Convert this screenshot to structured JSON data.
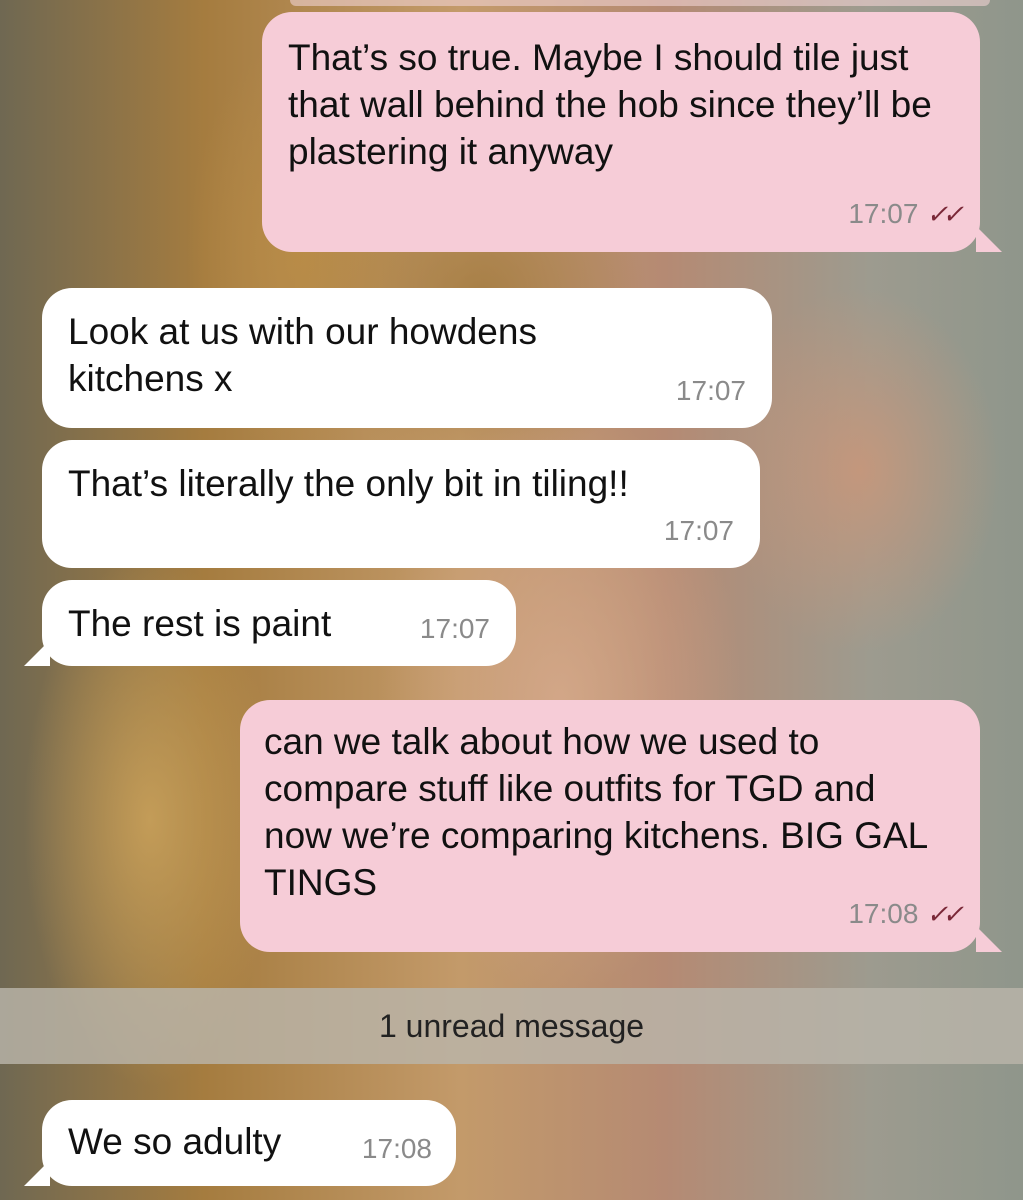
{
  "messages": [
    {
      "direction": "outgoing",
      "text": "That’s so true. Maybe I should tile just that wall behind the hob since they’ll be plastering it anyway",
      "time": "17:07",
      "status": "read"
    },
    {
      "direction": "incoming",
      "text": "Look at us with our howdens kitchens x",
      "time": "17:07"
    },
    {
      "direction": "incoming",
      "text": "That’s literally the only bit in tiling!!",
      "time": "17:07"
    },
    {
      "direction": "incoming",
      "text": "The rest is paint",
      "time": "17:07"
    },
    {
      "direction": "outgoing",
      "text": "can we talk about how we used to compare stuff like outfits for TGD and now we’re comparing kitchens. BIG GAL TINGS",
      "time": "17:08",
      "status": "read"
    },
    {
      "direction": "incoming",
      "text": "We so adulty",
      "time": "17:08"
    }
  ],
  "unread_divider": "1 unread message",
  "icons": {
    "read_receipt": "double-check-icon"
  },
  "colors": {
    "outgoing_bubble": "#f6ccd7",
    "incoming_bubble": "#ffffff",
    "read_check": "#7a2838"
  }
}
